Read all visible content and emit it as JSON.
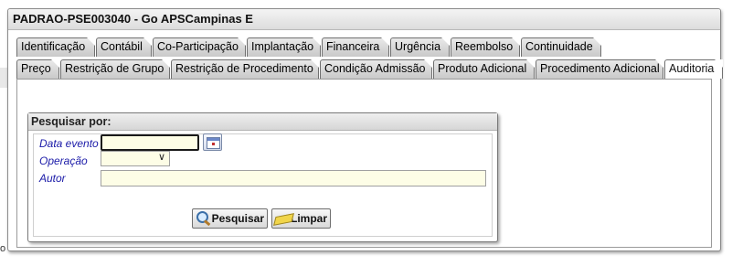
{
  "window": {
    "title": "PADRAO-PSE003040 - Go APSCampinas E"
  },
  "tabs_row1": [
    "Identificação",
    "Contábil",
    "Co-Participação",
    "Implantação",
    "Financeira",
    "Urgência",
    "Reembolso",
    "Continuidade"
  ],
  "tabs_row2": [
    "Preço",
    "Restrição de Grupo",
    "Restrição de Procedimento",
    "Condição Admissão",
    "Produto Adicional",
    "Procedimento Adicional",
    "Auditoria"
  ],
  "active_tab": "Auditoria",
  "search": {
    "title": "Pesquisar por:",
    "labels": {
      "data_evento": "Data evento",
      "operacao": "Operação",
      "autor": "Autor"
    },
    "values": {
      "data_evento": "",
      "operacao": "",
      "autor": ""
    },
    "operacao_arrow": "∨",
    "buttons": {
      "pesquisar": "Pesquisar",
      "limpar": "Limpar"
    }
  },
  "left_edge_char": "o",
  "icons": {
    "calendar": "calendar-icon",
    "search": "magnifier-icon",
    "clear": "eraser-icon"
  },
  "colors": {
    "field_bg": "#fdfde6",
    "label_blue": "#1a1aa8"
  }
}
